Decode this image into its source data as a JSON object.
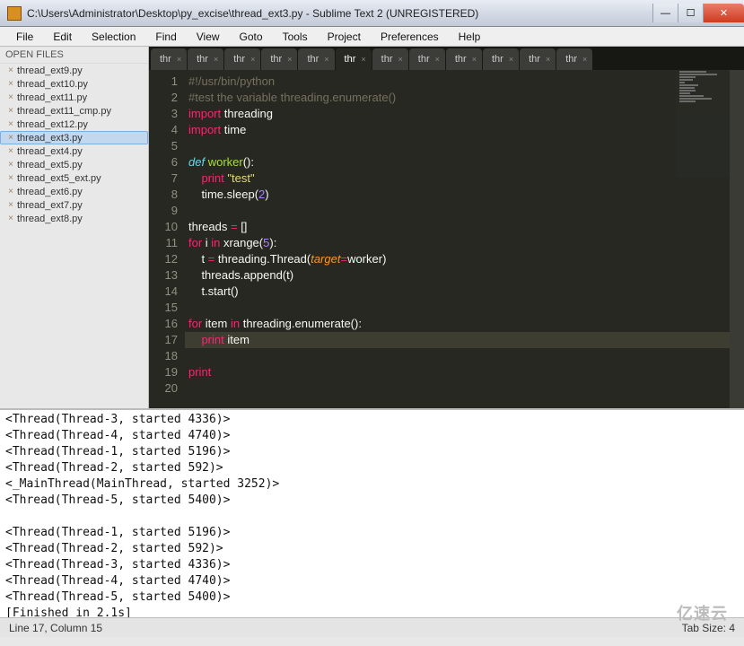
{
  "window": {
    "title": "C:\\Users\\Administrator\\Desktop\\py_excise\\thread_ext3.py - Sublime Text 2 (UNREGISTERED)"
  },
  "menu": {
    "items": [
      "File",
      "Edit",
      "Selection",
      "Find",
      "View",
      "Goto",
      "Tools",
      "Project",
      "Preferences",
      "Help"
    ]
  },
  "sidebar": {
    "header": "OPEN FILES",
    "files": [
      {
        "name": "thread_ext9.py",
        "active": false
      },
      {
        "name": "thread_ext10.py",
        "active": false
      },
      {
        "name": "thread_ext11.py",
        "active": false
      },
      {
        "name": "thread_ext11_cmp.py",
        "active": false
      },
      {
        "name": "thread_ext12.py",
        "active": false
      },
      {
        "name": "thread_ext3.py",
        "active": true
      },
      {
        "name": "thread_ext4.py",
        "active": false
      },
      {
        "name": "thread_ext5.py",
        "active": false
      },
      {
        "name": "thread_ext5_ext.py",
        "active": false
      },
      {
        "name": "thread_ext6.py",
        "active": false
      },
      {
        "name": "thread_ext7.py",
        "active": false
      },
      {
        "name": "thread_ext8.py",
        "active": false
      }
    ]
  },
  "tabs": {
    "items": [
      {
        "label": "thr",
        "active": false
      },
      {
        "label": "thr",
        "active": false
      },
      {
        "label": "thr",
        "active": false
      },
      {
        "label": "thr",
        "active": false
      },
      {
        "label": "thr",
        "active": false
      },
      {
        "label": "thr",
        "active": true
      },
      {
        "label": "thr",
        "active": false
      },
      {
        "label": "thr",
        "active": false
      },
      {
        "label": "thr",
        "active": false
      },
      {
        "label": "thr",
        "active": false
      },
      {
        "label": "thr",
        "active": false
      },
      {
        "label": "thr",
        "active": false
      }
    ]
  },
  "code": {
    "active_line_index": 16,
    "lines": [
      {
        "n": 1,
        "tokens": [
          {
            "t": "#!/usr/bin/python",
            "c": "cmt"
          }
        ]
      },
      {
        "n": 2,
        "tokens": [
          {
            "t": "#test the variable threading.enumerate()",
            "c": "cmt"
          }
        ]
      },
      {
        "n": 3,
        "tokens": [
          {
            "t": "import",
            "c": "kw-red"
          },
          {
            "t": " threading",
            "c": ""
          }
        ]
      },
      {
        "n": 4,
        "tokens": [
          {
            "t": "import",
            "c": "kw-red"
          },
          {
            "t": " time",
            "c": ""
          }
        ]
      },
      {
        "n": 5,
        "tokens": []
      },
      {
        "n": 6,
        "tokens": [
          {
            "t": "def",
            "c": "kw-blue"
          },
          {
            "t": " ",
            "c": ""
          },
          {
            "t": "worker",
            "c": "fn"
          },
          {
            "t": "():",
            "c": ""
          }
        ]
      },
      {
        "n": 7,
        "tokens": [
          {
            "t": "    ",
            "c": ""
          },
          {
            "t": "print",
            "c": "kw-red"
          },
          {
            "t": " ",
            "c": ""
          },
          {
            "t": "\"test\"",
            "c": "str"
          }
        ]
      },
      {
        "n": 8,
        "tokens": [
          {
            "t": "    time.sleep(",
            "c": ""
          },
          {
            "t": "2",
            "c": "num"
          },
          {
            "t": ")",
            "c": ""
          }
        ]
      },
      {
        "n": 9,
        "tokens": []
      },
      {
        "n": 10,
        "tokens": [
          {
            "t": "threads ",
            "c": ""
          },
          {
            "t": "=",
            "c": "op"
          },
          {
            "t": " []",
            "c": ""
          }
        ]
      },
      {
        "n": 11,
        "tokens": [
          {
            "t": "for",
            "c": "kw-red"
          },
          {
            "t": " i ",
            "c": ""
          },
          {
            "t": "in",
            "c": "kw-red"
          },
          {
            "t": " xrange(",
            "c": ""
          },
          {
            "t": "5",
            "c": "num"
          },
          {
            "t": "):",
            "c": ""
          }
        ]
      },
      {
        "n": 12,
        "tokens": [
          {
            "t": "    t ",
            "c": ""
          },
          {
            "t": "=",
            "c": "op"
          },
          {
            "t": " threading.Thread(",
            "c": ""
          },
          {
            "t": "target",
            "c": "arg"
          },
          {
            "t": "=",
            "c": "op"
          },
          {
            "t": "worker)",
            "c": ""
          }
        ]
      },
      {
        "n": 13,
        "tokens": [
          {
            "t": "    threads.append(t)",
            "c": ""
          }
        ]
      },
      {
        "n": 14,
        "tokens": [
          {
            "t": "    t.start()",
            "c": ""
          }
        ]
      },
      {
        "n": 15,
        "tokens": []
      },
      {
        "n": 16,
        "tokens": [
          {
            "t": "for",
            "c": "kw-red"
          },
          {
            "t": " item ",
            "c": ""
          },
          {
            "t": "in",
            "c": "kw-red"
          },
          {
            "t": " threading.enumerate():",
            "c": ""
          }
        ]
      },
      {
        "n": 17,
        "tokens": [
          {
            "t": "    ",
            "c": ""
          },
          {
            "t": "print",
            "c": "kw-red"
          },
          {
            "t": " item",
            "c": ""
          }
        ]
      },
      {
        "n": 18,
        "tokens": []
      },
      {
        "n": 19,
        "tokens": [
          {
            "t": "print",
            "c": "kw-red"
          }
        ]
      },
      {
        "n": 20,
        "tokens": []
      }
    ]
  },
  "output": {
    "lines": [
      "<Thread(Thread-3, started 4336)>",
      "<Thread(Thread-4, started 4740)>",
      "<Thread(Thread-1, started 5196)>",
      "<Thread(Thread-2, started 592)>",
      "<_MainThread(MainThread, started 3252)>",
      "<Thread(Thread-5, started 5400)>",
      "",
      "<Thread(Thread-1, started 5196)>",
      "<Thread(Thread-2, started 592)>",
      "<Thread(Thread-3, started 4336)>",
      "<Thread(Thread-4, started 4740)>",
      "<Thread(Thread-5, started 5400)>",
      "[Finished in 2.1s]"
    ]
  },
  "status": {
    "left": "Line 17, Column 15",
    "right": "Tab Size: 4"
  },
  "watermark": "亿速云"
}
